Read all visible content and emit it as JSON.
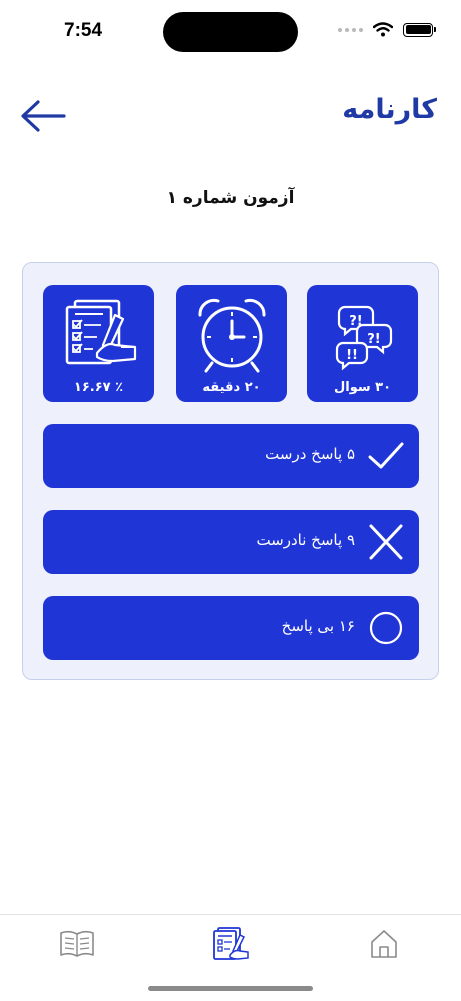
{
  "status": {
    "time": "7:54"
  },
  "header": {
    "title": "کارنامه"
  },
  "exam": {
    "name": "آزمون شماره ۱"
  },
  "stats": {
    "questions_label": "۳۰ سوال",
    "time_label": "۲۰ دقیقه",
    "percent_label": "٪ ۱۶.۶۷"
  },
  "results": {
    "correct_label": "۵ پاسخ درست",
    "incorrect_label": "۹ پاسخ نادرست",
    "unanswered_label": "۱۶ بی پاسخ"
  },
  "colors": {
    "primary": "#1f35d6",
    "title": "#1f3aa5",
    "card_bg": "#eef1fb"
  },
  "tabs": [
    "book-icon",
    "exam-results-icon",
    "home-icon"
  ]
}
